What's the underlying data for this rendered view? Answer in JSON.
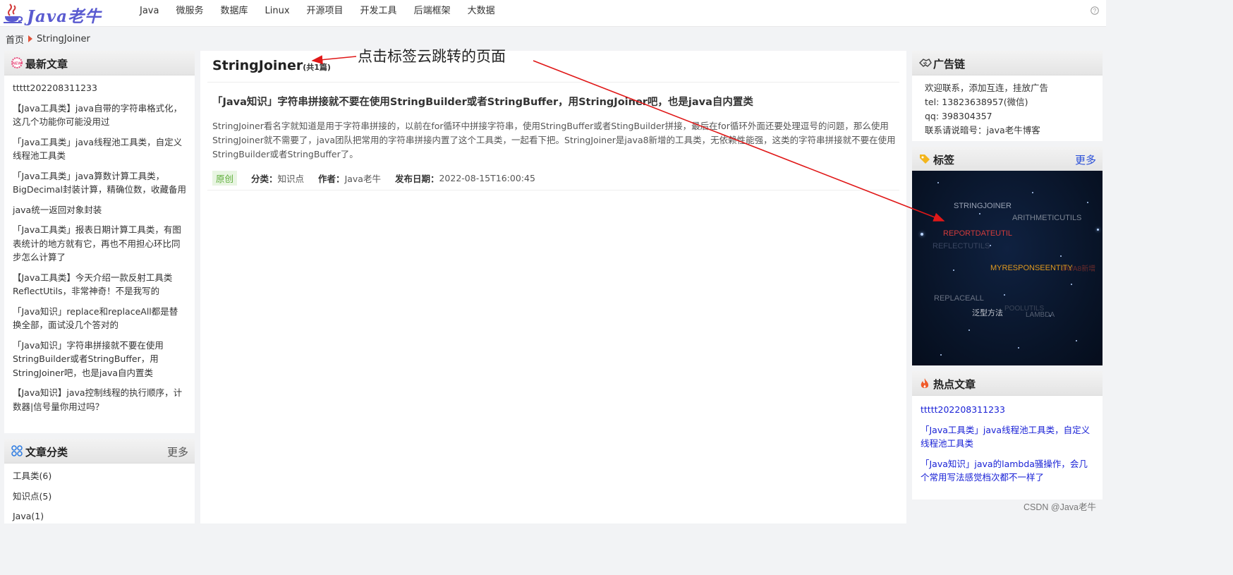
{
  "nav": {
    "logo_text": "Java老牛",
    "links": [
      "Java",
      "微服务",
      "数据库",
      "Linux",
      "开源项目",
      "开发工具",
      "后端框架",
      "大数据"
    ]
  },
  "breadcrumb": {
    "home": "首页",
    "current": "StringJoiner"
  },
  "latest": {
    "title": "最新文章",
    "items": [
      "ttttt202208311233",
      "【Java工具类】java自带的字符串格式化，这几个功能你可能没用过",
      "「Java工具类」java线程池工具类，自定义线程池工具类",
      "「Java工具类」java算数计算工具类，BigDecimal封装计算，精确位数，收藏备用",
      "java统一返回对象封装",
      "「Java工具类」报表日期计算工具类，有图表统计的地方就有它，再也不用担心环比同步怎么计算了",
      "【Java工具类】今天介绍一款反射工具类ReflectUtils，非常神奇！不是我写的",
      "「Java知识」replace和replaceAll都是替换全部，面试没几个答对的",
      "「Java知识」字符串拼接就不要在使用StringBuilder或者StringBuffer，用StringJoiner吧，也是java自内置类",
      "【Java知识】java控制线程的执行顺序，计数器|信号量你用过吗？"
    ]
  },
  "categories": {
    "title": "文章分类",
    "more": "更多",
    "items": [
      "工具类(6)",
      "知识点(5)",
      "Java(1)"
    ]
  },
  "main": {
    "tag": "StringJoiner",
    "count": "(共1篇)",
    "article_title": "「Java知识」字符串拼接就不要在使用StringBuilder或者StringBuffer，用StringJoiner吧，也是java自内置类",
    "summary": "StringJoiner看名字就知道是用于字符串拼接的，以前在for循环中拼接字符串，使用StringBuffer或者StingBuilder拼接，最后在for循环外面还要处理逗号的问题，那么使用StringJoiner就不需要了，java团队把常用的字符串拼接内置了这个工具类，一起看下把。StringJoiner是java8新增的工具类，无依赖性能强，这类的字符串拼接就不要在使用StringBuilder或者StringBuffer了。",
    "badge": "原创",
    "category_label": "分类：",
    "category": "知识点",
    "author_label": "作者：",
    "author": "Java老牛",
    "date_label": "发布日期：",
    "date": "2022-08-15T16:00:45"
  },
  "annotation": "点击标签云跳转的页面",
  "ad": {
    "title": "广告链",
    "lines": [
      "欢迎联系，添加互连，挂放广告",
      "tel: 13823638957(微信)",
      "qq: 398304357",
      "联系请说暗号：java老牛博客"
    ]
  },
  "tags": {
    "title": "标签",
    "more": "更多",
    "cloud": [
      {
        "text": "STRINGJOINER",
        "color": "#9aa3b5"
      },
      {
        "text": "ARITHMETICUTILS",
        "color": "#7d8694"
      },
      {
        "text": "REPORTDATEUTIL",
        "color": "#d13b3b"
      },
      {
        "text": "REFLECTUTILS",
        "color": "#3a4660"
      },
      {
        "text": "MYRESPONSEENTITY",
        "color": "#e29a1e"
      },
      {
        "text": "JAVA8新增",
        "color": "#6a2b2b"
      },
      {
        "text": "REPLACEALL",
        "color": "#6a7283"
      },
      {
        "text": "泛型方法",
        "color": "#c3c7cf"
      },
      {
        "text": "POOLUTILS",
        "color": "#3c4558"
      },
      {
        "text": "LAMBDA",
        "color": "#566072"
      }
    ]
  },
  "hot": {
    "title": "热点文章",
    "items": [
      "ttttt202208311233",
      "「Java工具类」java线程池工具类，自定义线程池工具类",
      "「Java知识」java的lambda骚操作，会几个常用写法感觉档次都不一样了"
    ]
  },
  "watermark": "CSDN @Java老牛",
  "colors": {
    "arrow": "#e01818",
    "hot_link": "#1a22d6",
    "badge_bg": "#e8f5e2"
  }
}
